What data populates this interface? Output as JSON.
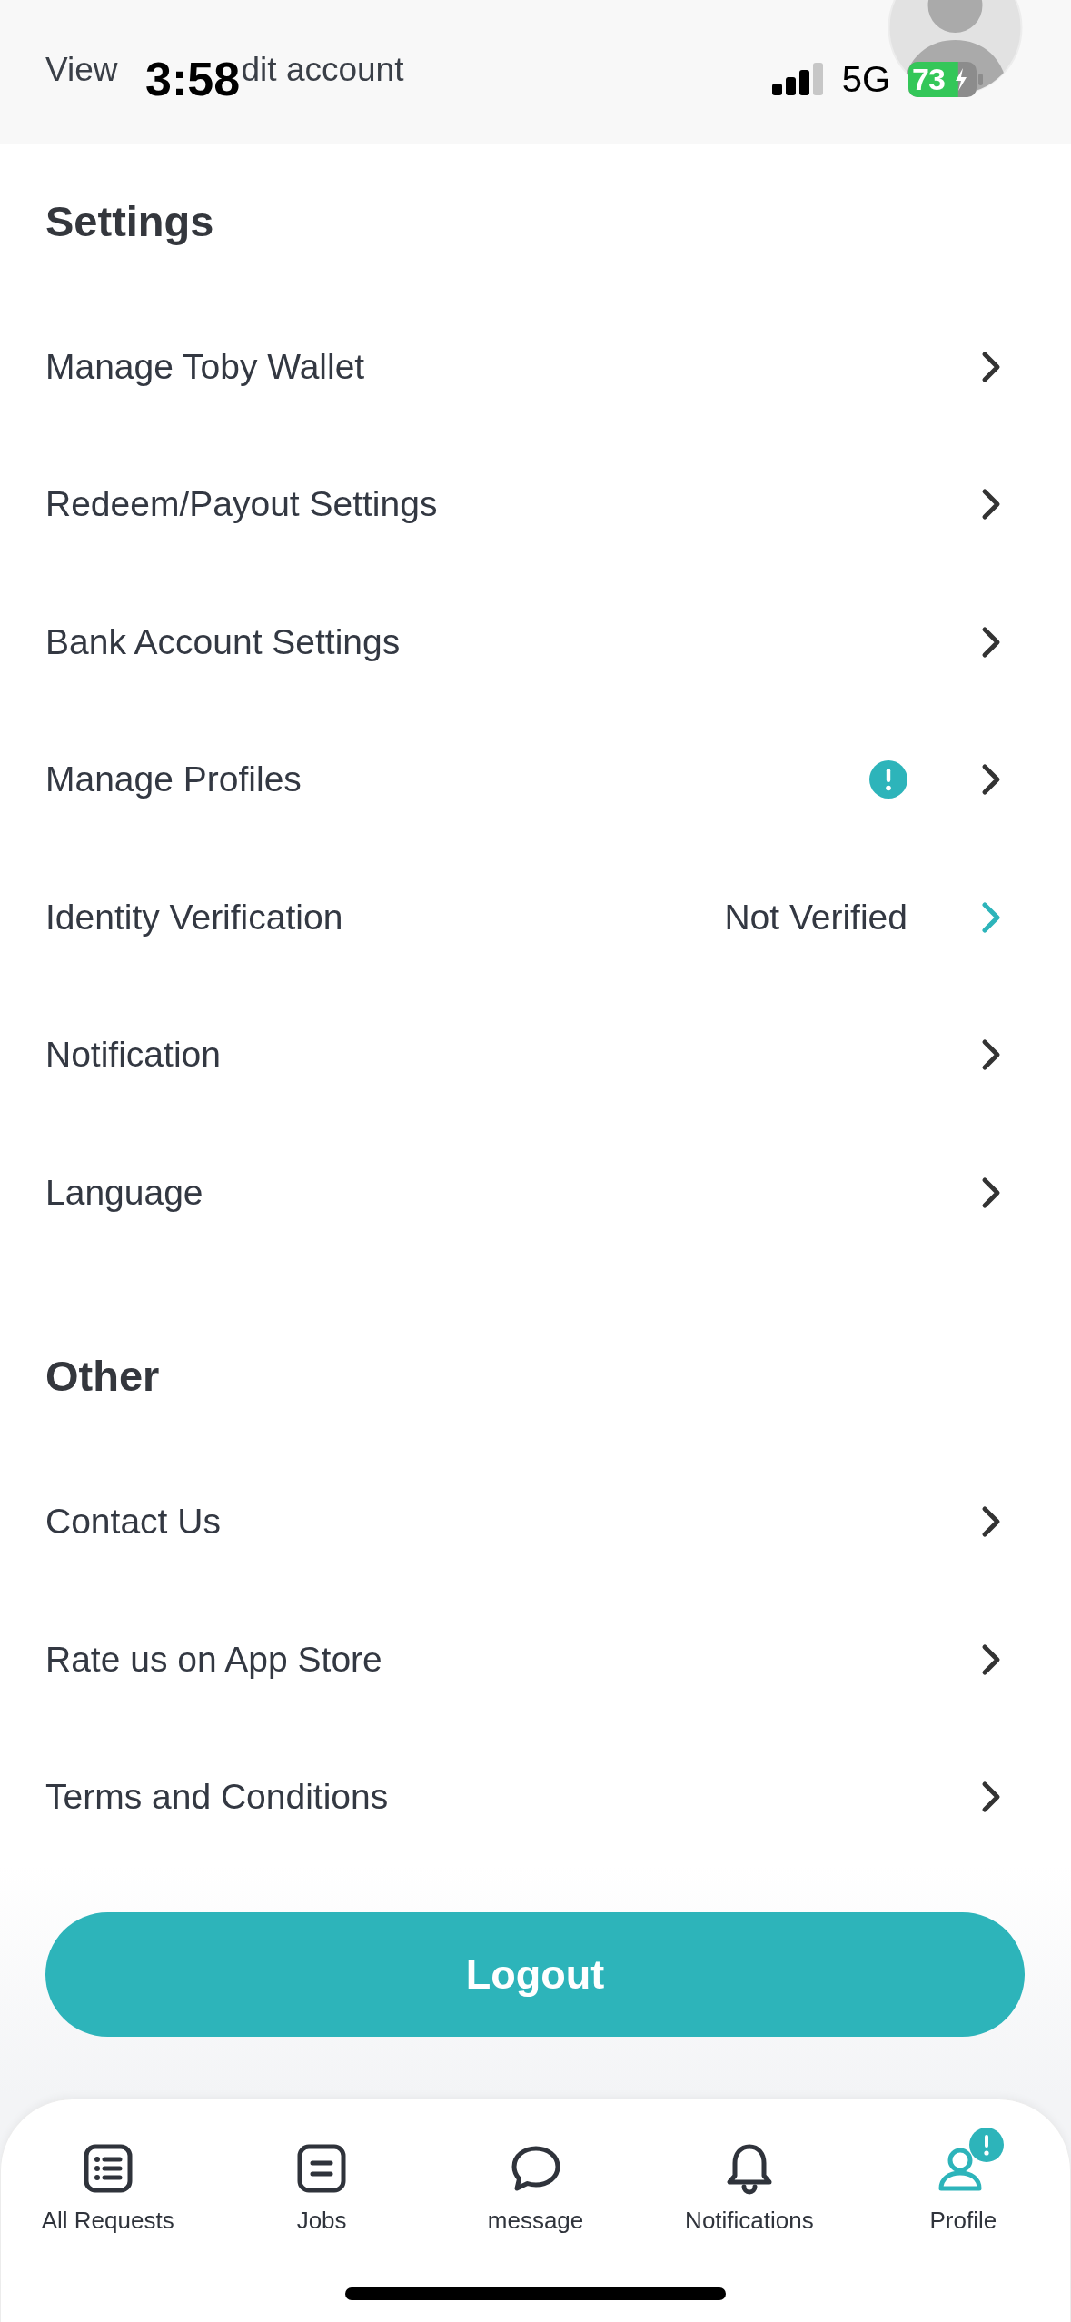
{
  "status_bar": {
    "time": "3:58",
    "network": "5G",
    "battery": "73",
    "charging": true
  },
  "header": {
    "subtitle_fragments": [
      "View",
      "dit account"
    ]
  },
  "sections": [
    {
      "title": "Settings",
      "items": [
        {
          "label": "Manage Toby Wallet",
          "alert": false,
          "highlight": false
        },
        {
          "label": "Redeem/Payout Settings",
          "alert": false,
          "highlight": false
        },
        {
          "label": "Bank Account Settings",
          "alert": false,
          "highlight": false
        },
        {
          "label": "Manage Profiles",
          "alert": true,
          "highlight": false
        },
        {
          "label": "Identity Verification",
          "value": "Not Verified",
          "alert": false,
          "highlight": true
        },
        {
          "label": "Notification",
          "alert": false,
          "highlight": false
        },
        {
          "label": "Language",
          "alert": false,
          "highlight": false
        }
      ]
    },
    {
      "title": "Other",
      "items": [
        {
          "label": "Contact Us",
          "alert": false,
          "highlight": false
        },
        {
          "label": "Rate us on App Store",
          "alert": false,
          "highlight": false
        },
        {
          "label": "Terms and Conditions",
          "alert": false,
          "highlight": false
        }
      ]
    }
  ],
  "logout": {
    "label": "Logout"
  },
  "tab_bar": [
    {
      "label": "All Requests",
      "selected": false,
      "badge": false
    },
    {
      "label": "Jobs",
      "selected": false,
      "badge": false
    },
    {
      "label": "message",
      "selected": false,
      "badge": false
    },
    {
      "label": "Notifications",
      "selected": false,
      "badge": false
    },
    {
      "label": "Profile",
      "selected": true,
      "badge": true
    }
  ]
}
